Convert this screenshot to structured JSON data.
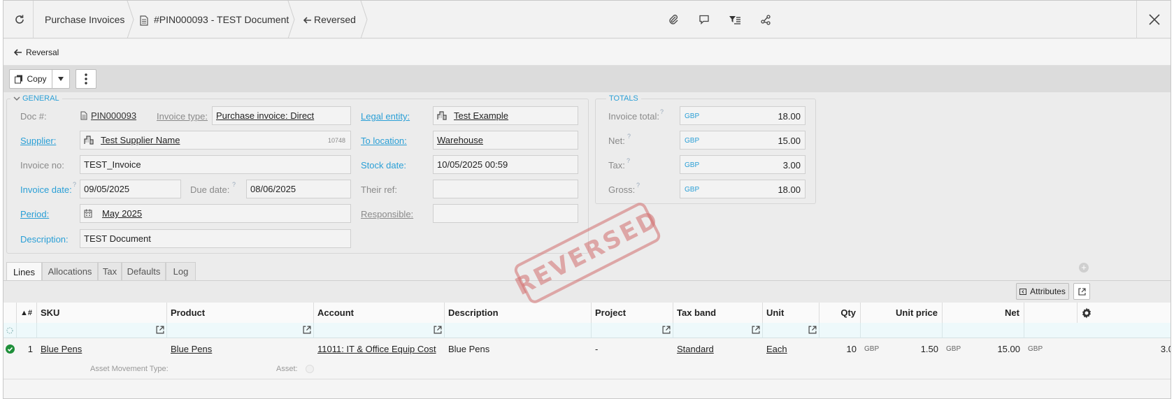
{
  "breadcrumbs": {
    "module": "Purchase Invoices",
    "document": "#PIN000093 - TEST Document",
    "status": "Reversed"
  },
  "subbar": {
    "reversal": "Reversal"
  },
  "toolbar": {
    "copy": "Copy"
  },
  "general": {
    "legend": "GENERAL",
    "doc_label": "Doc #:",
    "doc_value": "PIN000093",
    "invoice_type_label": "Invoice type:",
    "invoice_type_value": "Purchase invoice: Direct",
    "supplier_label": "Supplier:",
    "supplier_value": "Test Supplier Name",
    "supplier_code": "10748",
    "invoice_no_label": "Invoice no:",
    "invoice_no_value": "TEST_Invoice",
    "invoice_date_label": "Invoice date:",
    "invoice_date_value": "09/05/2025",
    "due_date_label": "Due date:",
    "due_date_value": "08/06/2025",
    "period_label": "Period:",
    "period_value": "May 2025",
    "description_label": "Description:",
    "description_value": "TEST Document",
    "legal_entity_label": "Legal entity:",
    "legal_entity_value": "Test Example",
    "to_location_label": "To location:",
    "to_location_value": "Warehouse",
    "stock_date_label": "Stock date:",
    "stock_date_value": "10/05/2025 00:59",
    "their_ref_label": "Their ref:",
    "their_ref_value": "",
    "responsible_label": "Responsible:",
    "responsible_value": ""
  },
  "totals": {
    "legend": "TOTALS",
    "currency": "GBP",
    "invoice_total_label": "Invoice total:",
    "invoice_total": "18.00",
    "net_label": "Net:",
    "net": "15.00",
    "tax_label": "Tax:",
    "tax": "3.00",
    "gross_label": "Gross:",
    "gross": "18.00"
  },
  "stamp": "REVERSED",
  "tabs": [
    "Lines",
    "Allocations",
    "Tax",
    "Defaults",
    "Log"
  ],
  "grid": {
    "attributes": "Attributes",
    "columns": {
      "num": "▲#",
      "sku": "SKU",
      "product": "Product",
      "account": "Account",
      "description": "Description",
      "project": "Project",
      "tax_band": "Tax band",
      "unit": "Unit",
      "qty": "Qty",
      "unit_price": "Unit price",
      "net": "Net"
    },
    "row": {
      "num": "1",
      "sku": "Blue Pens",
      "product": "Blue Pens",
      "account": "11011: IT & Office Equip Cost",
      "description": "Blue Pens",
      "project": "-",
      "tax_band": "Standard",
      "unit": "Each",
      "qty": "10",
      "currency": "GBP",
      "unit_price": "1.50",
      "net": "15.00",
      "gross": "3.0"
    },
    "asset_movement_label": "Asset Movement Type:",
    "asset_label": "Asset:"
  }
}
